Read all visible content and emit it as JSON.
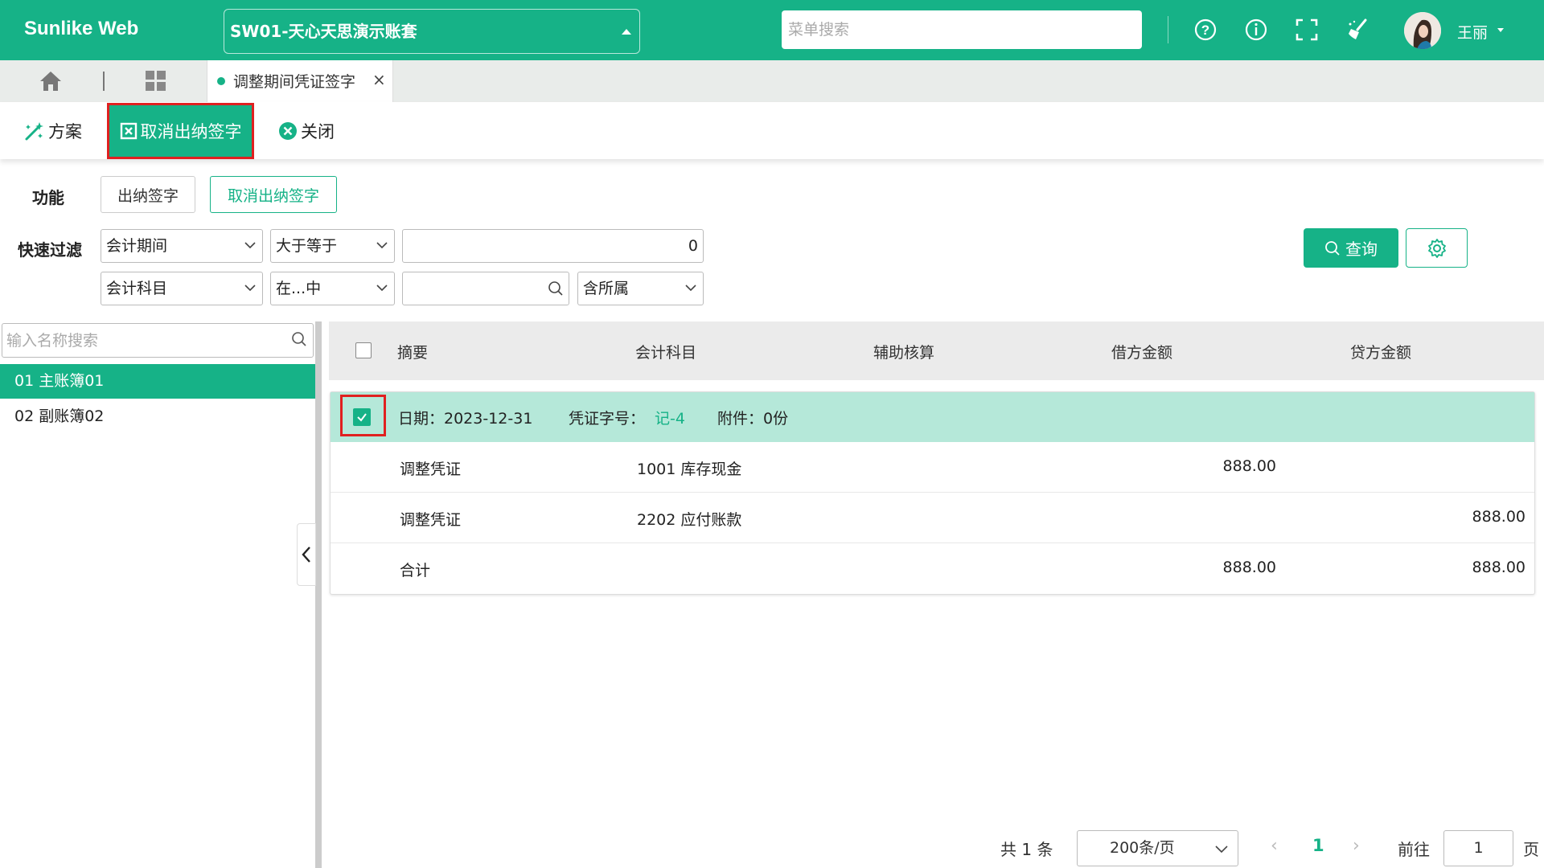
{
  "header": {
    "logo": "Sunlike Web",
    "account": "SW01-天心天思演示账套",
    "search_placeholder": "菜单搜索",
    "user_name": "王丽",
    "icons": [
      "help-circle-icon",
      "info-circle-icon",
      "fullscreen-icon",
      "broom-clean-icon"
    ]
  },
  "tabs": {
    "active_label": "调整期间凭证签字",
    "close": "×"
  },
  "toolbar": {
    "scheme": "方案",
    "cancel_cashier_sign": "取消出纳签字",
    "close": "关闭"
  },
  "function": {
    "label": "功能",
    "sign": "出纳签字",
    "cancel_sign": "取消出纳签字"
  },
  "filter": {
    "label": "快速过滤",
    "row1": {
      "field": "会计期间",
      "op": "大于等于",
      "value": "0"
    },
    "row2": {
      "field": "会计科目",
      "op": "在...中",
      "value": "",
      "scope": "含所属"
    },
    "query": "查询"
  },
  "tree": {
    "search_placeholder": "输入名称搜索",
    "items": [
      "01 主账簿01",
      "02 副账簿02"
    ]
  },
  "grid": {
    "columns": [
      "摘要",
      "会计科目",
      "辅助核算",
      "借方金额",
      "贷方金额"
    ],
    "voucher": {
      "date_label": "日期：2023-12-31",
      "no_label": "凭证字号：",
      "no_value": "记-4",
      "attach_label": "附件：0份"
    },
    "rows": [
      {
        "summary": "调整凭证",
        "subject": "1001 库存现金",
        "aux": "",
        "debit": "888.00",
        "credit": ""
      },
      {
        "summary": "调整凭证",
        "subject": "2202 应付账款",
        "aux": "",
        "debit": "",
        "credit": "888.00"
      },
      {
        "summary": "合计",
        "subject": "",
        "aux": "",
        "debit": "888.00",
        "credit": "888.00"
      }
    ]
  },
  "pager": {
    "total": "共 1 条",
    "page_size": "200条/页",
    "current_page": "1",
    "goto_label": "前往",
    "goto_value": "1",
    "page_suffix": "页"
  },
  "colors": {
    "brand": "#16b287",
    "highlight_row": "#b5e8d9",
    "annotation_red": "#e02020"
  }
}
